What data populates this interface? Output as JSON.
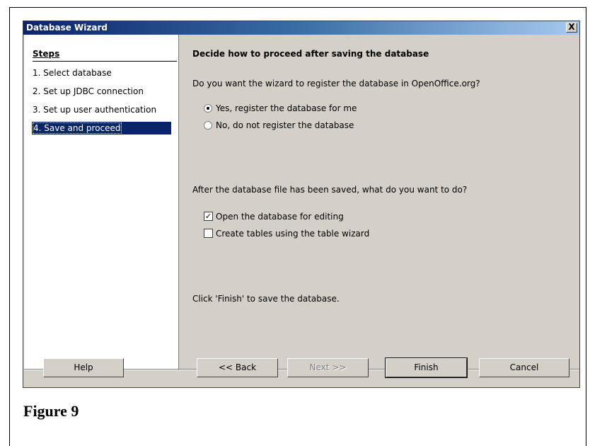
{
  "window": {
    "title": "Database Wizard",
    "close_label": "X"
  },
  "steps": {
    "title": "Steps",
    "items": [
      {
        "label": "1. Select database"
      },
      {
        "label": "2. Set up JDBC connection"
      },
      {
        "label": "3. Set up user authentication"
      },
      {
        "label": "4. Save and proceed"
      }
    ]
  },
  "main": {
    "heading": "Decide how to proceed after saving the database",
    "register_question": "Do you want the wizard to register the database in OpenOffice.org?",
    "radio_yes": "Yes, register the database for me",
    "radio_no": "No, do not register the database",
    "after_question": "After the database file has been saved, what do you want to do?",
    "check_open": "Open the database for editing",
    "check_create": "Create tables using the table wizard",
    "finish_hint": "Click 'Finish' to save the database."
  },
  "buttons": {
    "help": "Help",
    "back": "<< Back",
    "next": "Next >>",
    "finish": "Finish",
    "cancel": "Cancel"
  },
  "caption": "Figure 9"
}
